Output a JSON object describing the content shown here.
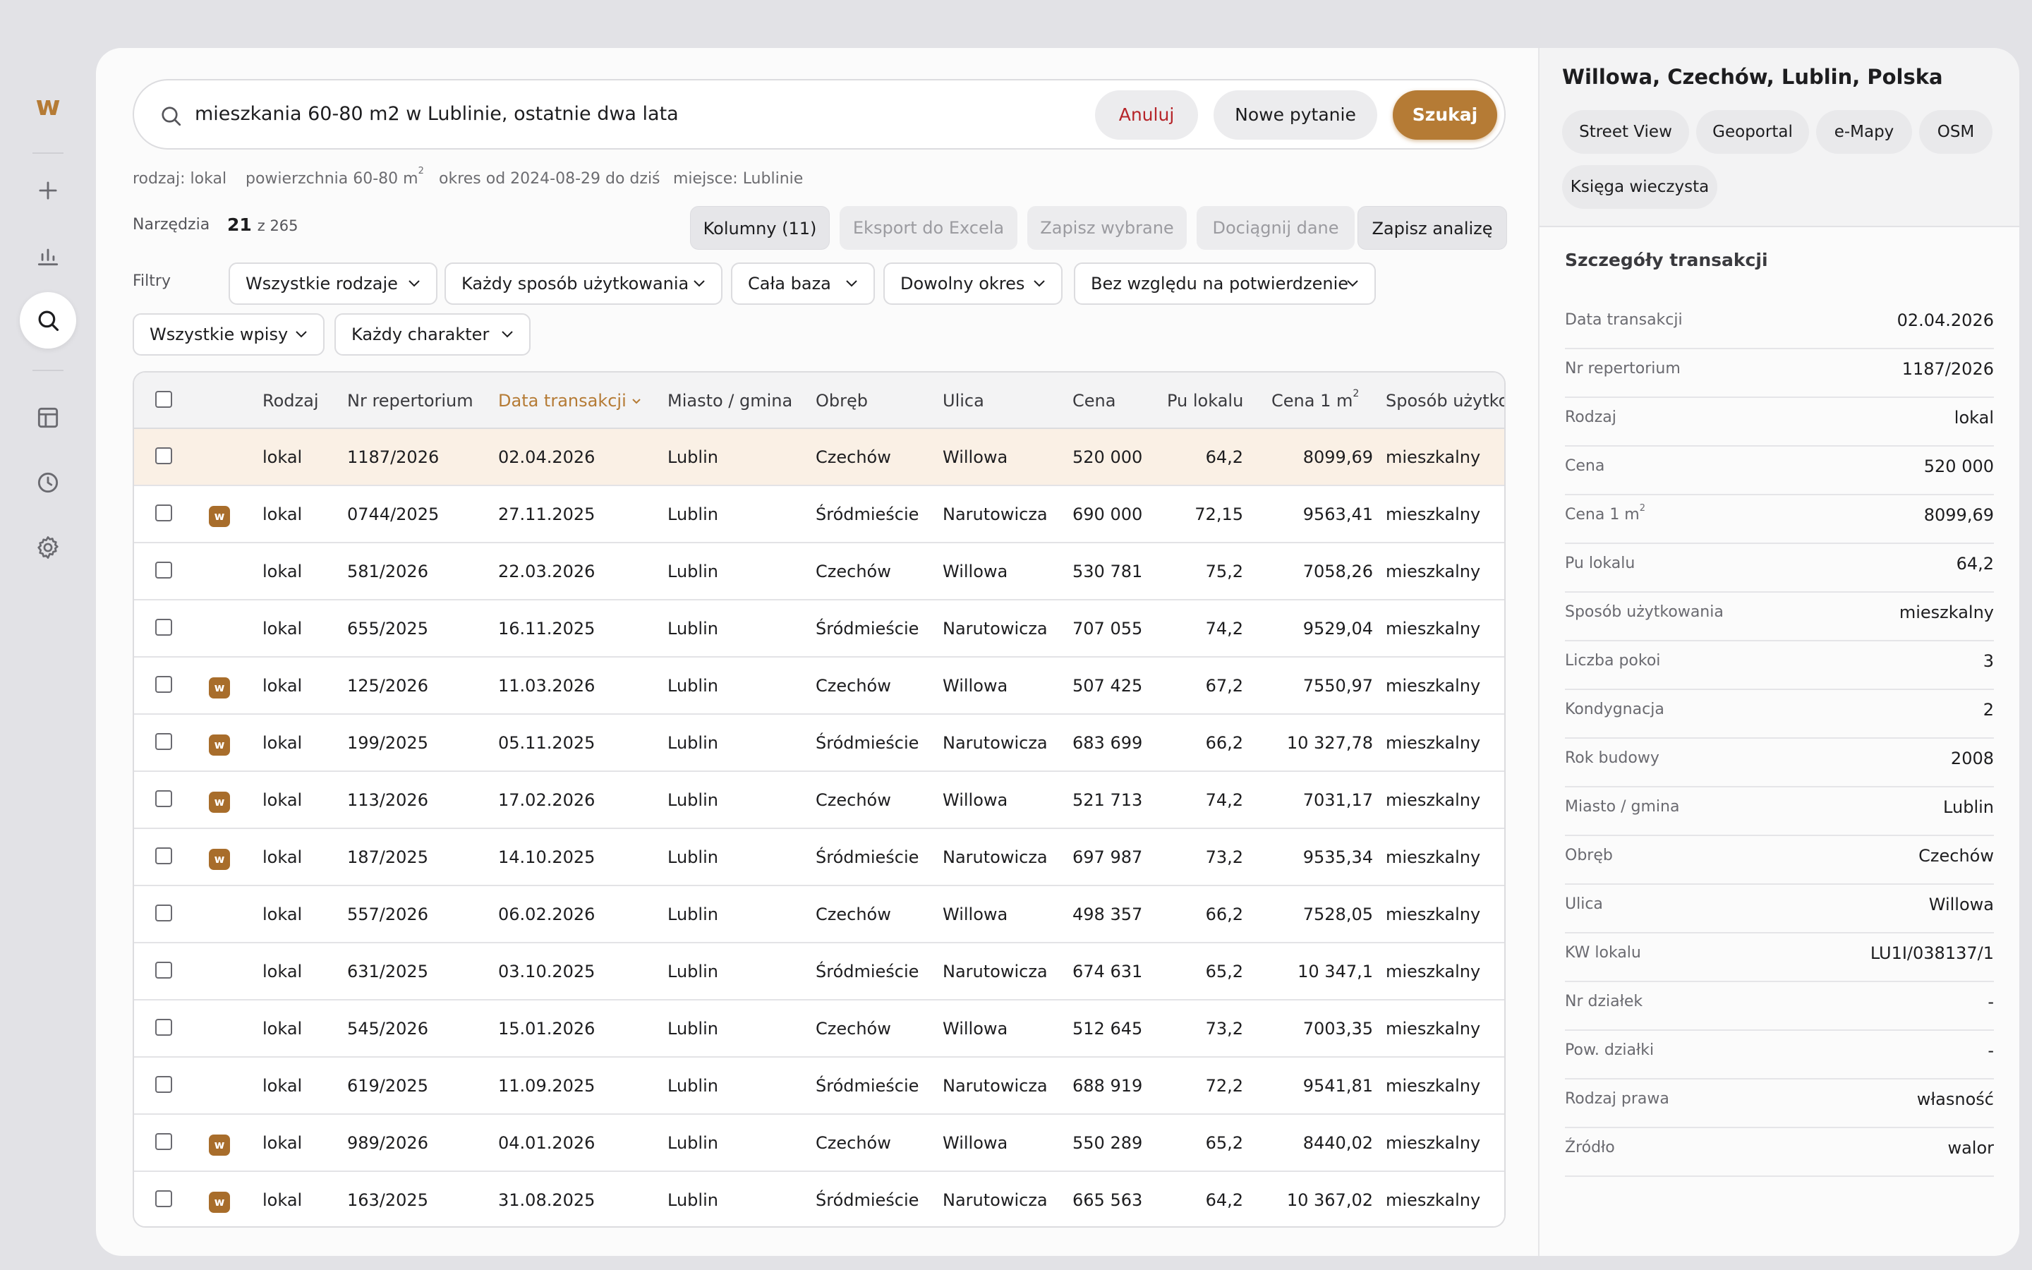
{
  "sidebar": {
    "logo": "w",
    "icons": [
      "plus-icon",
      "chart-icon",
      "search-icon",
      "layout-icon",
      "clock-icon",
      "gear-icon"
    ],
    "active": "search-icon"
  },
  "search": {
    "query": "mieszkania 60-80 m2 w Lublinie, ostatnie dwa lata",
    "cancel_label": "Anuluj",
    "new_question_label": "Nowe pytanie",
    "search_label": "Szukaj"
  },
  "criteria": {
    "type": "rodzaj: lokal",
    "area_prefix": "powierzchnia 60-80 m",
    "area_sup": "2",
    "period": "okres od 2024-08-29 do dziś",
    "place": "miejsce: Lublinie"
  },
  "tools": {
    "label": "Narzędzia",
    "count_shown": "21",
    "count_total": "z 265",
    "columns_label": "Kolumny (11)",
    "export_label": "Eksport do Excela",
    "save_selected_label": "Zapisz wybrane",
    "fetch_label": "Dociągnij dane",
    "save_analysis_label": "Zapisz analizę"
  },
  "filters": {
    "label": "Filtry",
    "items": [
      "Wszystkie rodzaje",
      "Każdy sposób użytkowania",
      "Cała baza",
      "Dowolny okres",
      "Bez względu na potwierdzenie",
      "Wszystkie wpisy",
      "Każdy charakter"
    ]
  },
  "table": {
    "columns": [
      "Rodzaj",
      "Nr repertorium",
      "Data transakcji",
      "Miasto / gmina",
      "Obręb",
      "Ulica",
      "Cena",
      "Pu lokalu",
      "Cena 1 m",
      "Sposób użytkow"
    ],
    "sorted_column": "Data transakcji",
    "rows": [
      {
        "badge": "",
        "rodzaj": "lokal",
        "nr": "1187/2026",
        "data": "02.04.2026",
        "miasto": "Lublin",
        "obreb": "Czechów",
        "ulica": "Willowa",
        "cena": "520 000",
        "pu": "64,2",
        "cena_m2": "8099,69",
        "sposob": "mieszkalny"
      },
      {
        "badge": "w",
        "rodzaj": "lokal",
        "nr": "0744/2025",
        "data": "27.11.2025",
        "miasto": "Lublin",
        "obreb": "Śródmieście",
        "ulica": "Narutowicza",
        "cena": "690 000",
        "pu": "72,15",
        "cena_m2": "9563,41",
        "sposob": "mieszkalny"
      },
      {
        "badge": "",
        "rodzaj": "lokal",
        "nr": "581/2026",
        "data": "22.03.2026",
        "miasto": "Lublin",
        "obreb": "Czechów",
        "ulica": "Willowa",
        "cena": "530 781",
        "pu": "75,2",
        "cena_m2": "7058,26",
        "sposob": "mieszkalny"
      },
      {
        "badge": "",
        "rodzaj": "lokal",
        "nr": "655/2025",
        "data": "16.11.2025",
        "miasto": "Lublin",
        "obreb": "Śródmieście",
        "ulica": "Narutowicza",
        "cena": "707 055",
        "pu": "74,2",
        "cena_m2": "9529,04",
        "sposob": "mieszkalny"
      },
      {
        "badge": "w",
        "rodzaj": "lokal",
        "nr": "125/2026",
        "data": "11.03.2026",
        "miasto": "Lublin",
        "obreb": "Czechów",
        "ulica": "Willowa",
        "cena": "507 425",
        "pu": "67,2",
        "cena_m2": "7550,97",
        "sposob": "mieszkalny"
      },
      {
        "badge": "w",
        "rodzaj": "lokal",
        "nr": "199/2025",
        "data": "05.11.2025",
        "miasto": "Lublin",
        "obreb": "Śródmieście",
        "ulica": "Narutowicza",
        "cena": "683 699",
        "pu": "66,2",
        "cena_m2": "10 327,78",
        "sposob": "mieszkalny"
      },
      {
        "badge": "w",
        "rodzaj": "lokal",
        "nr": "113/2026",
        "data": "17.02.2026",
        "miasto": "Lublin",
        "obreb": "Czechów",
        "ulica": "Willowa",
        "cena": "521 713",
        "pu": "74,2",
        "cena_m2": "7031,17",
        "sposob": "mieszkalny"
      },
      {
        "badge": "w",
        "rodzaj": "lokal",
        "nr": "187/2025",
        "data": "14.10.2025",
        "miasto": "Lublin",
        "obreb": "Śródmieście",
        "ulica": "Narutowicza",
        "cena": "697 987",
        "pu": "73,2",
        "cena_m2": "9535,34",
        "sposob": "mieszkalny"
      },
      {
        "badge": "",
        "rodzaj": "lokal",
        "nr": "557/2026",
        "data": "06.02.2026",
        "miasto": "Lublin",
        "obreb": "Czechów",
        "ulica": "Willowa",
        "cena": "498 357",
        "pu": "66,2",
        "cena_m2": "7528,05",
        "sposob": "mieszkalny"
      },
      {
        "badge": "",
        "rodzaj": "lokal",
        "nr": "631/2025",
        "data": "03.10.2025",
        "miasto": "Lublin",
        "obreb": "Śródmieście",
        "ulica": "Narutowicza",
        "cena": "674 631",
        "pu": "65,2",
        "cena_m2": "10 347,1",
        "sposob": "mieszkalny"
      },
      {
        "badge": "",
        "rodzaj": "lokal",
        "nr": "545/2026",
        "data": "15.01.2026",
        "miasto": "Lublin",
        "obreb": "Czechów",
        "ulica": "Willowa",
        "cena": "512 645",
        "pu": "73,2",
        "cena_m2": "7003,35",
        "sposob": "mieszkalny"
      },
      {
        "badge": "",
        "rodzaj": "lokal",
        "nr": "619/2025",
        "data": "11.09.2025",
        "miasto": "Lublin",
        "obreb": "Śródmieście",
        "ulica": "Narutowicza",
        "cena": "688 919",
        "pu": "72,2",
        "cena_m2": "9541,81",
        "sposob": "mieszkalny"
      },
      {
        "badge": "w",
        "rodzaj": "lokal",
        "nr": "989/2026",
        "data": "04.01.2026",
        "miasto": "Lublin",
        "obreb": "Czechów",
        "ulica": "Willowa",
        "cena": "550 289",
        "pu": "65,2",
        "cena_m2": "8440,02",
        "sposob": "mieszkalny"
      },
      {
        "badge": "w",
        "rodzaj": "lokal",
        "nr": "163/2025",
        "data": "31.08.2025",
        "miasto": "Lublin",
        "obreb": "Śródmieście",
        "ulica": "Narutowicza",
        "cena": "665 563",
        "pu": "64,2",
        "cena_m2": "10 367,02",
        "sposob": "mieszkalny"
      }
    ]
  },
  "panel": {
    "address": "Willowa, Czechów, Lublin, Polska",
    "links": [
      "Street View",
      "Geoportal",
      "e-Mapy",
      "OSM",
      "Księga wieczysta"
    ],
    "section_title": "Szczegóły transakcji",
    "details": [
      {
        "k": "Data transakcji",
        "v": "02.04.2026"
      },
      {
        "k": "Nr repertorium",
        "v": "1187/2026"
      },
      {
        "k": "Rodzaj",
        "v": "lokal"
      },
      {
        "k": "Cena",
        "v": "520 000"
      },
      {
        "k": "Cena 1 m",
        "v": "8099,69"
      },
      {
        "k": "Pu lokalu",
        "v": "64,2"
      },
      {
        "k": "Sposób użytkowania",
        "v": "mieszkalny"
      },
      {
        "k": "Liczba pokoi",
        "v": "3"
      },
      {
        "k": "Kondygnacja",
        "v": "2"
      },
      {
        "k": "Rok budowy",
        "v": "2008"
      },
      {
        "k": "Miasto / gmina",
        "v": "Lublin"
      },
      {
        "k": "Obręb",
        "v": "Czechów"
      },
      {
        "k": "Ulica",
        "v": "Willowa"
      },
      {
        "k": "KW lokalu",
        "v": "LU1I/038137/1"
      },
      {
        "k": "Nr działek",
        "v": "-"
      },
      {
        "k": "Pow. działki",
        "v": "-"
      },
      {
        "k": "Rodzaj prawa",
        "v": "własność"
      },
      {
        "k": "Źródło",
        "v": "walor"
      }
    ]
  },
  "colors": {
    "accent": "#b57b35",
    "danger": "#b6252a",
    "selected_row": "#faf0e5"
  }
}
